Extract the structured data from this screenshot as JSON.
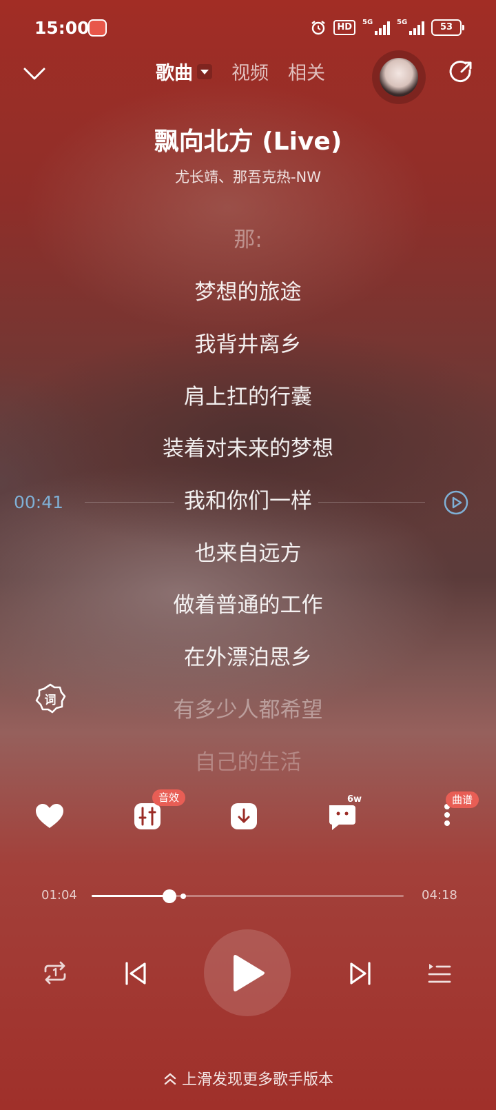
{
  "status_bar": {
    "time": "15:00",
    "hd_label": "HD",
    "sim1_label": "5G",
    "sim2_label": "5G",
    "battery": "53"
  },
  "top_bar": {
    "tabs": [
      {
        "label": "歌曲",
        "active": true
      },
      {
        "label": "视频",
        "active": false
      },
      {
        "label": "相关",
        "active": false
      }
    ]
  },
  "song": {
    "title": "飘向北方 (Live)",
    "artist": "尤长靖、那吾克热-NW"
  },
  "lyrics": {
    "lines": [
      "那:",
      "梦想的旅途",
      "我背井离乡",
      "肩上扛的行囊",
      "装着对未来的梦想",
      "我和你们一样",
      "也来自远方",
      "做着普通的工作",
      "在外漂泊思乡",
      "有多少人都希望",
      "自己的生活"
    ],
    "seek_time": "00:41",
    "lyric_badge": "词"
  },
  "actions": {
    "effects_tag": "音效",
    "comment_count": "6w",
    "score_tag": "曲谱"
  },
  "progress": {
    "current": "01:04",
    "total": "04:18",
    "fraction": 0.25,
    "buffered": 0.294
  },
  "footer": {
    "hint": "上滑发现更多歌手版本"
  },
  "colors": {
    "accent_red": "#e85e55",
    "seek_blue": "#7fb0d6"
  }
}
